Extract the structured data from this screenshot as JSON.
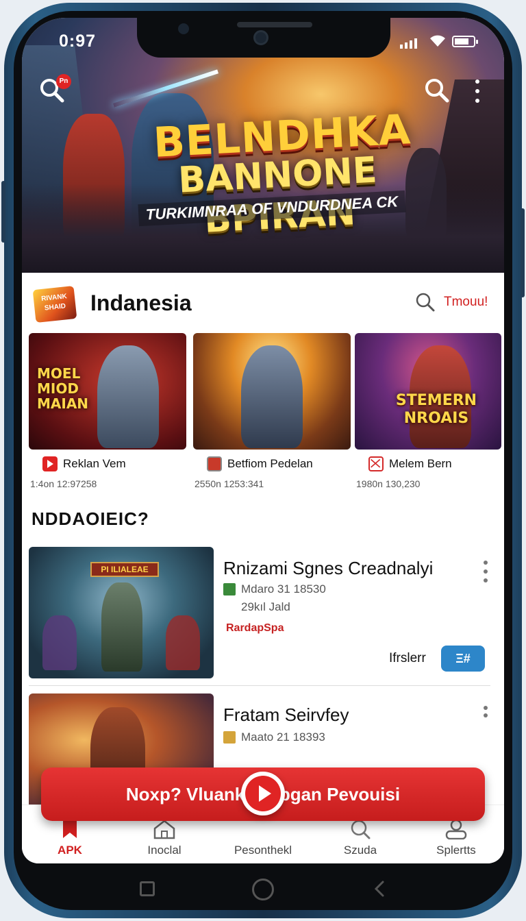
{
  "status": {
    "time": "0:97"
  },
  "hero": {
    "title_line1": "BELNDHKA",
    "title_line2": "BANNONE BPIRAN",
    "subtitle": "TURKIMNRAA OF VNDURDNEA CK",
    "badge": "Pn"
  },
  "section1": {
    "logo_text": "RIVANK SHAID",
    "title": "Indanesia",
    "action": "Tmouu!"
  },
  "cards": [
    {
      "overlay": "MOEL MIOD MAIAN",
      "title": "Reklan Vem",
      "meta": "1:4on 12:97258",
      "icon_color": "#e02424"
    },
    {
      "overlay": "",
      "title": "Betfiom Pedelan",
      "meta": "2550n 1253:341",
      "icon_color": "#c83a2a"
    },
    {
      "overlay": "STEMERN NROAIS",
      "title": "Melem Bern",
      "meta": "1980n 130,230",
      "icon_color": "#d42a2a"
    }
  ],
  "section2": {
    "title": "NDDAOIEIC?"
  },
  "list": [
    {
      "banner": "PI ILIALEAE",
      "title": "Rnizami Sgnes Creadnalyi",
      "meta1": "Mdaro 31 18530",
      "meta2": "29kıl Jald",
      "brand": "RardapSpa",
      "install_label": "Ifrslerr",
      "install_button": "Ξ#"
    },
    {
      "title": "Fratam Seirvfey",
      "meta1": "Maato 21 18393"
    }
  ],
  "promo": {
    "text": "Noxp? Vluankar Ubgan Pevouisi"
  },
  "nav": [
    {
      "label": "APK",
      "icon": "bookmark-icon",
      "active": true
    },
    {
      "label": "Inoclal",
      "icon": "home-icon",
      "active": false
    },
    {
      "label": "Pesonthekl",
      "icon": "play-icon",
      "active": false
    },
    {
      "label": "Szuda",
      "icon": "search-icon",
      "active": false
    },
    {
      "label": "Splertts",
      "icon": "profile-icon",
      "active": false
    }
  ],
  "colors": {
    "accent": "#d11f1f",
    "install": "#2d86c9"
  }
}
